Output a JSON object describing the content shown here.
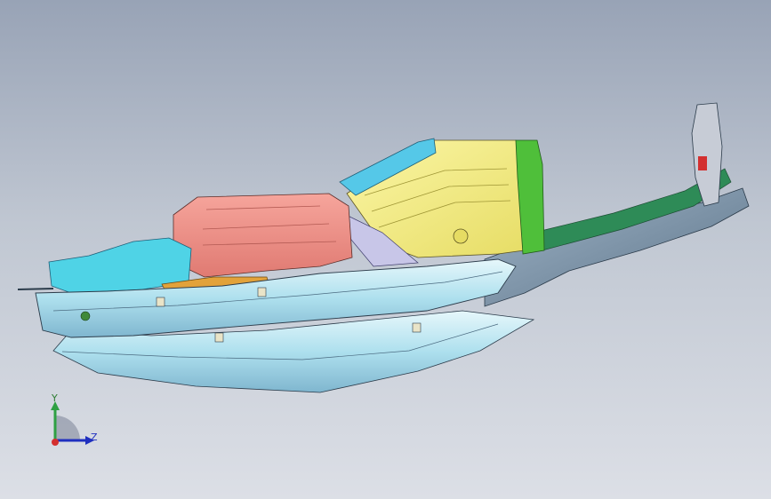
{
  "viewport": {
    "background_top": "#98a3b6",
    "background_bottom": "#dcdfe6"
  },
  "model": {
    "icon": "cad-vehicle-underbody-assembly",
    "part_colors": {
      "rocker": "#aee6f2",
      "rear_floor": "#f6f08a",
      "tunnel": "#ef8e86",
      "front_bracket": "#4fd3e6",
      "rear_rail": "#2e8b57",
      "pillar": "#c7ccd6",
      "crossmember": "#e2a23a"
    }
  },
  "triad": {
    "icon": "coordinate-triad-icon",
    "y_label": "Y",
    "z_label": "Z",
    "colors": {
      "x": "#d32f2f",
      "y": "#2ea043",
      "z": "#1f2fbf"
    }
  }
}
